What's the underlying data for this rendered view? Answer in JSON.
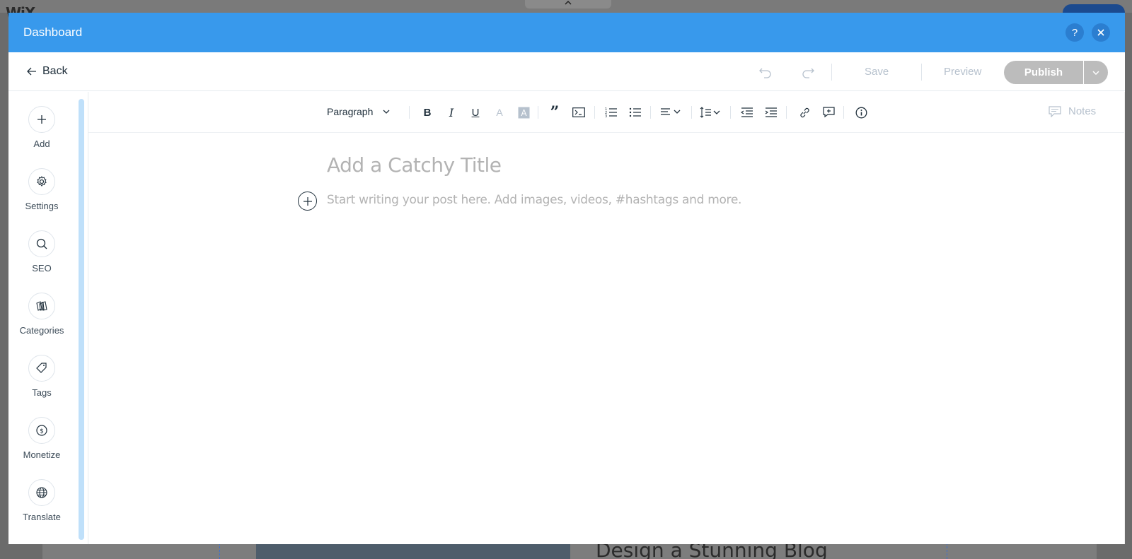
{
  "background": {
    "logo": "WiX",
    "heading": "Design a Stunning Blog"
  },
  "header": {
    "title": "Dashboard",
    "help_icon": "question-icon",
    "close_icon": "close-icon"
  },
  "toolbar": {
    "back_label": "Back",
    "save_label": "Save",
    "preview_label": "Preview",
    "publish_label": "Publish"
  },
  "sidebar": {
    "items": [
      {
        "label": "Add",
        "icon": "plus-icon"
      },
      {
        "label": "Settings",
        "icon": "gear-icon"
      },
      {
        "label": "SEO",
        "icon": "search-icon"
      },
      {
        "label": "Categories",
        "icon": "categories-icon"
      },
      {
        "label": "Tags",
        "icon": "tag-icon"
      },
      {
        "label": "Monetize",
        "icon": "dollar-icon"
      },
      {
        "label": "Translate",
        "icon": "globe-icon"
      }
    ]
  },
  "editor": {
    "paragraph_style": "Paragraph",
    "notes_label": "Notes",
    "title_placeholder": "Add a Catchy Title",
    "body_placeholder": "Start writing your post here. Add images, videos, #hashtags and more."
  },
  "colors": {
    "header": "#3899ec",
    "publish_disabled": "#bcbcbc",
    "placeholder": "#b3b3b3",
    "accent_scroll": "#bfe0fa"
  }
}
